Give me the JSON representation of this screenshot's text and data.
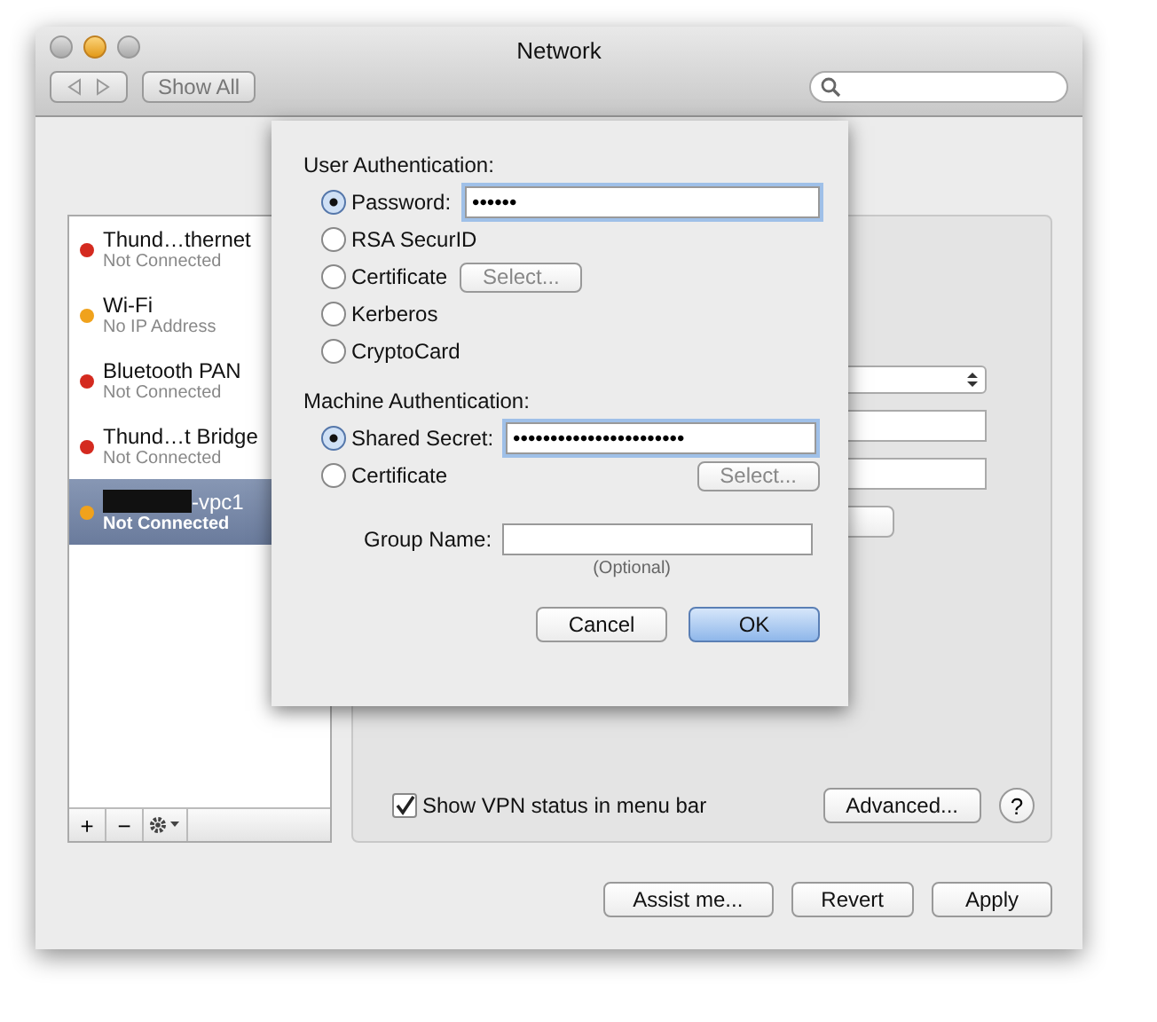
{
  "window": {
    "title": "Network"
  },
  "toolbar": {
    "show_all": "Show All"
  },
  "services": [
    {
      "name": "Thund…thernet",
      "status": "Not Connected",
      "color": "#d42a1f",
      "selected": false,
      "redacted": false
    },
    {
      "name": "Wi-Fi",
      "status": "No IP Address",
      "color": "#f0a21c",
      "selected": false,
      "redacted": false
    },
    {
      "name": "Bluetooth PAN",
      "status": "Not Connected",
      "color": "#d42a1f",
      "selected": false,
      "redacted": false
    },
    {
      "name": "Thund…t Bridge",
      "status": "Not Connected",
      "color": "#d42a1f",
      "selected": false,
      "redacted": false
    },
    {
      "name": "-vpc1",
      "status": "Not Connected",
      "color": "#f0a21c",
      "selected": true,
      "redacted": true
    }
  ],
  "service_controls": [
    "+",
    "−"
  ],
  "panel": {
    "show_status": {
      "label": "Show VPN status in menu bar",
      "checked": true
    },
    "advanced": "Advanced...",
    "help": "?"
  },
  "sheet": {
    "user_auth": {
      "heading": "User Authentication:",
      "options": [
        {
          "kind": "secret",
          "label": "Password:",
          "selected": true,
          "value": "••••••"
        },
        {
          "kind": "plain",
          "label": "RSA SecurID",
          "selected": false
        },
        {
          "kind": "select",
          "label": "Certificate",
          "selected": false,
          "button": "Select...",
          "disabled": true
        },
        {
          "kind": "plain",
          "label": "Kerberos",
          "selected": false
        },
        {
          "kind": "plain",
          "label": "CryptoCard",
          "selected": false
        }
      ]
    },
    "machine_auth": {
      "heading": "Machine Authentication:",
      "options": [
        {
          "kind": "secret",
          "label": "Shared Secret:",
          "selected": true,
          "value": "•••••••••••••••••••••••"
        },
        {
          "kind": "select_right",
          "label": "Certificate",
          "selected": false,
          "button": "Select...",
          "disabled": true
        }
      ]
    },
    "group_name": {
      "label": "Group Name:",
      "hint": "(Optional)"
    },
    "buttons": [
      {
        "label": "Cancel",
        "default": false
      },
      {
        "label": "OK",
        "default": true
      }
    ]
  },
  "buttons": [
    "Assist me...",
    "Revert",
    "Apply"
  ]
}
